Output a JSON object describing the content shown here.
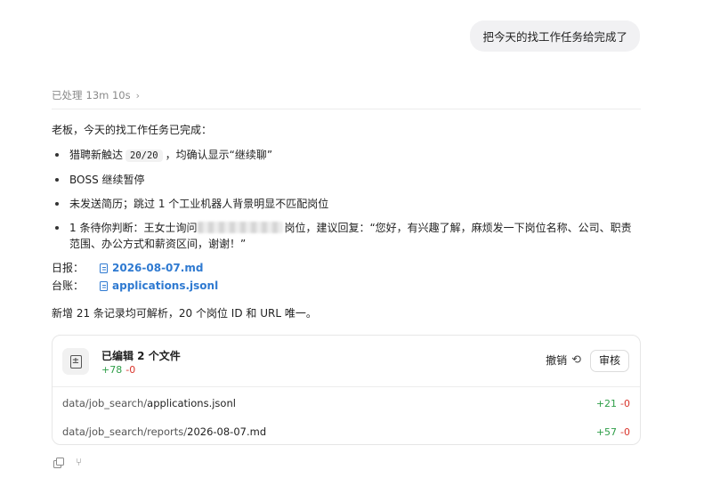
{
  "user_message": "把今天的找工作任务给完成了",
  "processed": {
    "label": "已处理",
    "duration": "13m 10s",
    "chevron": "›"
  },
  "reply": {
    "intro": "老板，今天的找工作任务已完成：",
    "bullets": {
      "b1_pre": "猎聘新触达",
      "b1_code": "20/20",
      "b1_post": "，均确认显示“继续聊”",
      "b2": "BOSS 继续暂停",
      "b3": "未发送简历；跳过 1 个工业机器人背景明显不匹配岗位",
      "b4_pre": "1 条待你判断：王女士询问",
      "b4_post": "岗位，建议回复：“您好，有兴趣了解，麻烦发一下岗位名称、公司、职责范围、办公方式和薪资区间，谢谢！”"
    },
    "daily_label": "日报：",
    "daily_file": "2026-08-07.md",
    "ledger_label": "台账：",
    "ledger_file": "applications.jsonl",
    "summary": "新增 21 条记录均可解析，20 个岗位 ID 和 URL 唯一。"
  },
  "edit_card": {
    "title": "已编辑 2 个文件",
    "added": "+78",
    "removed": "-0",
    "undo_label": "撤销",
    "undo_icon": "undo-icon",
    "review_label": "审核",
    "files": [
      {
        "dir": "data/job_search/",
        "name": "applications.jsonl",
        "added": "+21",
        "removed": "-0"
      },
      {
        "dir": "data/job_search/reports/",
        "name": "2026-08-07.md",
        "added": "+57",
        "removed": "-0"
      }
    ]
  },
  "colors": {
    "added": "#2e9e48",
    "removed": "#d9342b",
    "link": "#2f7ad1"
  },
  "footer_icons": [
    "copy-icon",
    "branch-icon"
  ]
}
